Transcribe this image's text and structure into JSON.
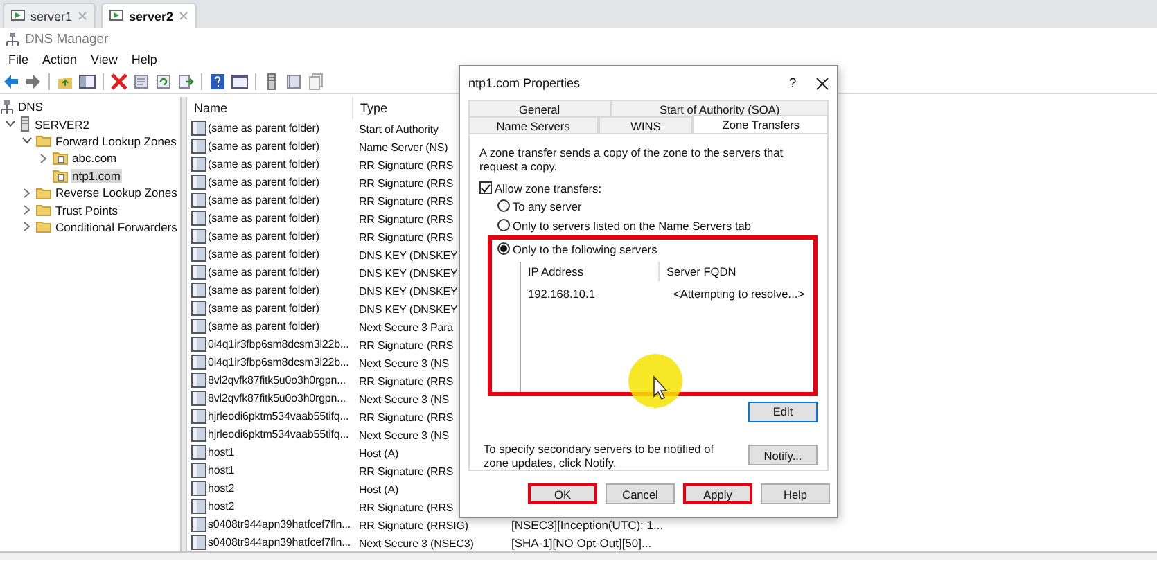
{
  "vm_tabs": [
    {
      "label": "server1",
      "selected": false
    },
    {
      "label": "server2",
      "selected": true
    }
  ],
  "app": {
    "title": "DNS Manager",
    "menu": [
      "File",
      "Action",
      "View",
      "Help"
    ]
  },
  "tree": [
    {
      "label": "DNS",
      "kind": "root",
      "selected": false,
      "children": [
        {
          "label": "SERVER2",
          "kind": "server",
          "expanded": true,
          "selected": false,
          "children": [
            {
              "label": "Forward Lookup Zones",
              "kind": "folder",
              "expanded": true,
              "selected": false,
              "children": [
                {
                  "label": "abc.com",
                  "kind": "zone",
                  "expanded": false,
                  "selected": false
                },
                {
                  "label": "ntp1.com",
                  "kind": "zone",
                  "selected": true
                }
              ]
            },
            {
              "label": "Reverse Lookup Zones",
              "kind": "folder",
              "expanded": false,
              "selected": false
            },
            {
              "label": "Trust Points",
              "kind": "folder",
              "expanded": false,
              "selected": false
            },
            {
              "label": "Conditional Forwarders",
              "kind": "folder",
              "expanded": false,
              "selected": false
            }
          ]
        }
      ]
    }
  ],
  "list": {
    "columns": [
      "Name",
      "Type"
    ],
    "rows": [
      {
        "name": "(same as parent folder)",
        "type": "Start of Authority"
      },
      {
        "name": "(same as parent folder)",
        "type": "Name Server (NS)"
      },
      {
        "name": "(same as parent folder)",
        "type": "RR Signature (RRS"
      },
      {
        "name": "(same as parent folder)",
        "type": "RR Signature (RRS"
      },
      {
        "name": "(same as parent folder)",
        "type": "RR Signature (RRS"
      },
      {
        "name": "(same as parent folder)",
        "type": "RR Signature (RRS"
      },
      {
        "name": "(same as parent folder)",
        "type": "RR Signature (RRS"
      },
      {
        "name": "(same as parent folder)",
        "type": "DNS KEY (DNSKEY"
      },
      {
        "name": "(same as parent folder)",
        "type": "DNS KEY (DNSKEY"
      },
      {
        "name": "(same as parent folder)",
        "type": "DNS KEY (DNSKEY"
      },
      {
        "name": "(same as parent folder)",
        "type": "DNS KEY (DNSKEY"
      },
      {
        "name": "(same as parent folder)",
        "type": "Next Secure 3 Para"
      },
      {
        "name": "0i4q1ir3fbp6sm8dcsm3l22b...",
        "type": "RR Signature (RRS"
      },
      {
        "name": "0i4q1ir3fbp6sm8dcsm3l22b...",
        "type": "Next Secure 3 (NS"
      },
      {
        "name": "8vl2qvfk87fitk5u0o3h0rgpn...",
        "type": "RR Signature (RRS"
      },
      {
        "name": "8vl2qvfk87fitk5u0o3h0rgpn...",
        "type": "Next Secure 3 (NS"
      },
      {
        "name": "hjrleodi6pktm534vaab55tifq...",
        "type": "RR Signature (RRS"
      },
      {
        "name": "hjrleodi6pktm534vaab55tifq...",
        "type": "Next Secure 3 (NS"
      },
      {
        "name": "host1",
        "type": "Host (A)"
      },
      {
        "name": "host1",
        "type": "RR Signature (RRS"
      },
      {
        "name": "host2",
        "type": "Host (A)"
      },
      {
        "name": "host2",
        "type": "RR Signature (RRS"
      },
      {
        "name": "s0408tr944apn39hatfcef7fln...",
        "type": "RR Signature (RRSIG)",
        "column_3": "[NSEC3][Inception(UTC): 1..."
      },
      {
        "name": "s0408tr944apn39hatfcef7fln...",
        "type": "Next Secure 3 (NSEC3)",
        "column_3": "[SHA-1][NO Opt-Out][50]..."
      }
    ]
  },
  "dialog": {
    "title": "ntp1.com Properties",
    "help_glyph": "?",
    "tab_rows": [
      {
        "tabs": [
          {
            "label": "General",
            "selected": false
          },
          {
            "label": "Start of Authority (SOA)",
            "selected": false
          }
        ]
      },
      {
        "tabs": [
          {
            "label": "Name Servers",
            "selected": false
          },
          {
            "label": "WINS",
            "selected": false
          },
          {
            "label": "Zone Transfers",
            "selected": true
          }
        ]
      }
    ],
    "description": "A zone transfer sends a copy of the zone to the servers that request a copy.",
    "allow_transfers": {
      "label": "Allow zone transfers:",
      "checked": true
    },
    "options": [
      {
        "label": "To any server",
        "selected": false,
        "highlighted": false
      },
      {
        "label": "Only to servers listed on the Name Servers tab",
        "selected": false,
        "highlighted": false
      },
      {
        "label": "Only to the following servers",
        "selected": true,
        "highlighted": true
      }
    ],
    "servers": {
      "columns": [
        "IP Address",
        "Server FQDN"
      ],
      "rows": [
        {
          "ip": "192.168.10.1",
          "fqdn": "<Attempting to resolve...>"
        }
      ]
    },
    "edit_button": "Edit",
    "notify_text": "To specify secondary servers to be notified of zone updates, click Notify.",
    "notify_button": "Notify...",
    "buttons": [
      {
        "label": "OK",
        "highlighted": true
      },
      {
        "label": "Cancel",
        "highlighted": false
      },
      {
        "label": "Apply",
        "highlighted": true
      },
      {
        "label": "Help",
        "highlighted": false
      }
    ]
  }
}
